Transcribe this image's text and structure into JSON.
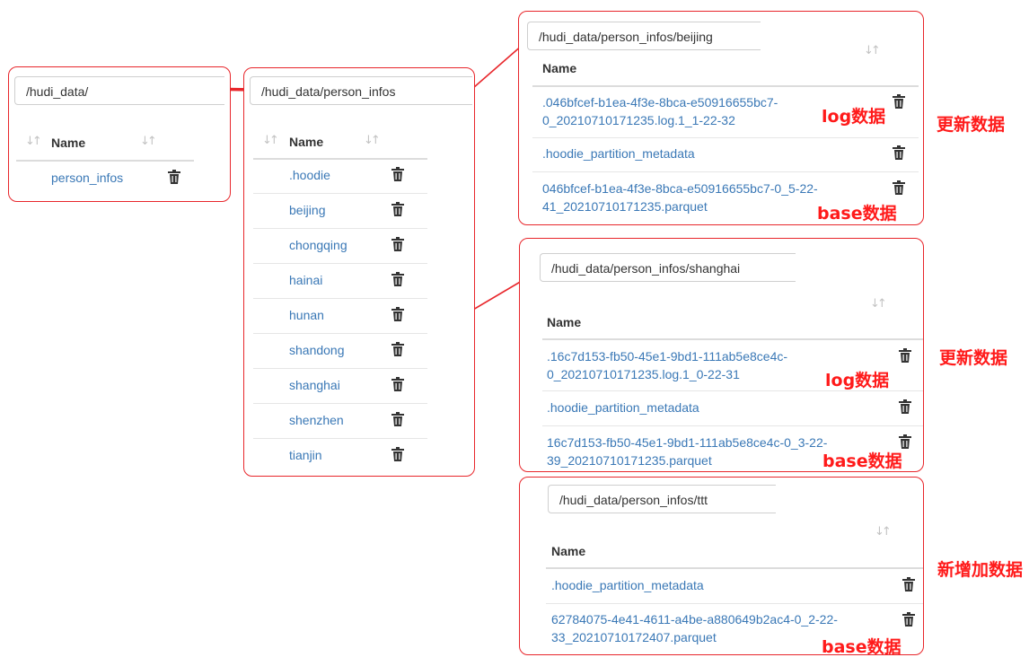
{
  "panels": [
    {
      "path": "/hudi_data/",
      "name_header": "Name",
      "items": [
        [
          "person_infos"
        ]
      ]
    },
    {
      "path": "/hudi_data/person_infos",
      "name_header": "Name",
      "items": [
        [
          ".hoodie"
        ],
        [
          "beijing"
        ],
        [
          "chongqing"
        ],
        [
          "hainai"
        ],
        [
          "hunan"
        ],
        [
          "shandong"
        ],
        [
          "shanghai"
        ],
        [
          "shenzhen"
        ],
        [
          "tianjin"
        ]
      ]
    },
    {
      "path": "/hudi_data/person_infos/beijing",
      "name_header": "Name",
      "items": [
        [
          ".046bfcef-b1ea-4f3e-8bca-e50916655bc7-",
          "0_20210710171235.log.1_1-22-32"
        ],
        [
          ".hoodie_partition_metadata"
        ],
        [
          "046bfcef-b1ea-4f3e-8bca-e50916655bc7-0_5-22-",
          "41_20210710171235.parquet"
        ]
      ]
    },
    {
      "path": "/hudi_data/person_infos/shanghai",
      "name_header": "Name",
      "items": [
        [
          ".16c7d153-fb50-45e1-9bd1-111ab5e8ce4c-",
          "0_20210710171235.log.1_0-22-31"
        ],
        [
          ".hoodie_partition_metadata"
        ],
        [
          "16c7d153-fb50-45e1-9bd1-111ab5e8ce4c-0_3-22-",
          "39_20210710171235.parquet"
        ]
      ]
    },
    {
      "path": "/hudi_data/person_infos/ttt",
      "name_header": "Name",
      "items": [
        [
          ".hoodie_partition_metadata"
        ],
        [
          "62784075-4e41-4611-a4be-a880649b2ac4-0_2-22-",
          "33_20210710172407.parquet"
        ]
      ]
    }
  ],
  "annotations": {
    "log": "log数据",
    "base": "base数据",
    "update": "更新数据",
    "new": "新增加数据"
  },
  "colors": {
    "accent": "#e8262b",
    "link": "#3a78b6"
  },
  "icons": [
    "sort-icon",
    "trash-icon"
  ]
}
